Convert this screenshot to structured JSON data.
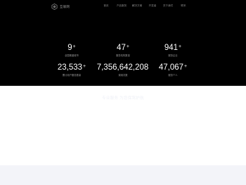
{
  "header": {
    "logo_text": "互联网",
    "nav": [
      "首页",
      "产品服务",
      "解决方案",
      "开发者",
      "关于我们",
      "联系"
    ]
  },
  "stats": [
    {
      "value": "9",
      "suffix": "+",
      "label": "全国覆盖城市"
    },
    {
      "value": "47",
      "suffix": "+",
      "label": "服务机构数量"
    },
    {
      "value": "941",
      "suffix": "+",
      "label": "服务企业"
    },
    {
      "value": "23,533",
      "suffix": "+",
      "label": "累计用户服务数量"
    },
    {
      "value": "7,356,642,208",
      "suffix": "",
      "label": "调用次数"
    },
    {
      "value": "47,067",
      "suffix": "+",
      "label": "服务个人"
    }
  ],
  "section": {
    "faint_title": "专业服务 为您保驾护航"
  }
}
